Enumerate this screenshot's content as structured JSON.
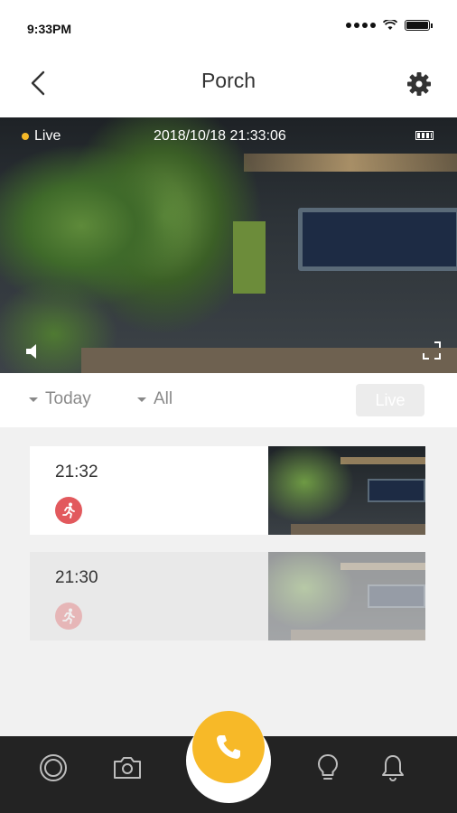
{
  "status_bar": {
    "time": "9:33PM"
  },
  "header": {
    "title": "Porch"
  },
  "video": {
    "live_label": "Live",
    "timestamp": "2018/10/18 21:33:06"
  },
  "filters": {
    "date_label": "Today",
    "type_label": "All",
    "live_button": "Live"
  },
  "events": [
    {
      "time": "21:32",
      "type": "motion"
    },
    {
      "time": "21:30",
      "type": "motion"
    }
  ],
  "tabbar": {
    "icons": [
      "record-icon",
      "camera-icon",
      "phone-icon",
      "bulb-icon",
      "bell-icon"
    ]
  },
  "colors": {
    "accent": "#f7b928",
    "motion": "#e2595d",
    "tabbar": "#232323"
  }
}
